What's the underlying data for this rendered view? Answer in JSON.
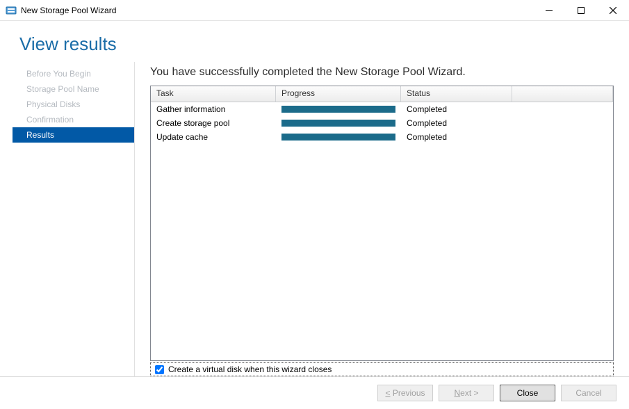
{
  "window": {
    "title": "New Storage Pool Wizard"
  },
  "heading": "View results",
  "sidebar": {
    "items": [
      {
        "label": "Before You Begin",
        "active": false
      },
      {
        "label": "Storage Pool Name",
        "active": false
      },
      {
        "label": "Physical Disks",
        "active": false
      },
      {
        "label": "Confirmation",
        "active": false
      },
      {
        "label": "Results",
        "active": true
      }
    ]
  },
  "main": {
    "success_text": "You have successfully completed the New Storage Pool Wizard.",
    "columns": {
      "task": "Task",
      "prog": "Progress",
      "status": "Status"
    },
    "rows": [
      {
        "task": "Gather information",
        "progress": 100,
        "status": "Completed"
      },
      {
        "task": "Create storage pool",
        "progress": 100,
        "status": "Completed"
      },
      {
        "task": "Update cache",
        "progress": 100,
        "status": "Completed"
      }
    ],
    "checkbox": {
      "checked": true,
      "label": "Create a virtual disk when this wizard closes"
    }
  },
  "footer": {
    "previous": "< Previous",
    "next": "Next >",
    "close": "Close",
    "cancel": "Cancel"
  },
  "colors": {
    "accent": "#0259a6",
    "heading": "#1b6da8",
    "progress": "#1b6b8a"
  }
}
